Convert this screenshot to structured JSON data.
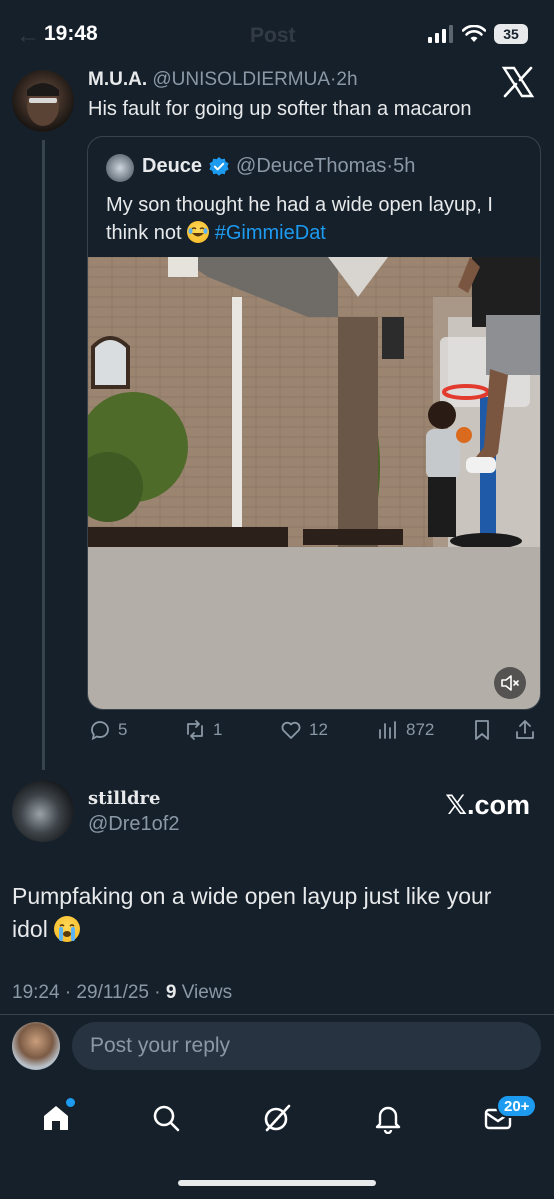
{
  "status_bar": {
    "time": "19:48",
    "battery": "35"
  },
  "header": {
    "back_icon": "arrow-left-icon",
    "title": "Post"
  },
  "main_tweet": {
    "author_name": "M.U.A.",
    "author_handle": "@UNISOLDIERMUA",
    "separator": "·",
    "time_ago": "2h",
    "text": "His fault for going up softer than a macaron"
  },
  "quoted_tweet": {
    "author_name": "Deuce",
    "author_handle": "@DeuceThomas",
    "separator": "·",
    "time_ago": "5h",
    "text_before": "My son thought he had a wide open layup, I think not",
    "hashtag": "#GimmieDat",
    "colors": {
      "hashtag": "#1d9bf0",
      "verified": "#1d9bf0"
    }
  },
  "actions": {
    "replies": "5",
    "reposts": "1",
    "likes": "12",
    "views": "872"
  },
  "reply_tweet": {
    "author_name": "stilldre",
    "author_handle": "@Dre1of2",
    "source_label": "𝕏.com",
    "text": "Pumpfaking on a wide open layup just like your idol",
    "timestamp": "19:24 · 29/11/25 · ",
    "views_count": "9",
    "views_label": " Views"
  },
  "composer": {
    "placeholder": "Post your reply"
  },
  "bottom_nav": {
    "items": [
      "home-icon",
      "search-icon",
      "grok-icon",
      "bell-icon",
      "mail-icon"
    ],
    "messages_badge": "20+"
  },
  "colors": {
    "background": "#15202b",
    "accent": "#1d9bf0",
    "muted": "#8b98a5",
    "border": "#38444d"
  }
}
